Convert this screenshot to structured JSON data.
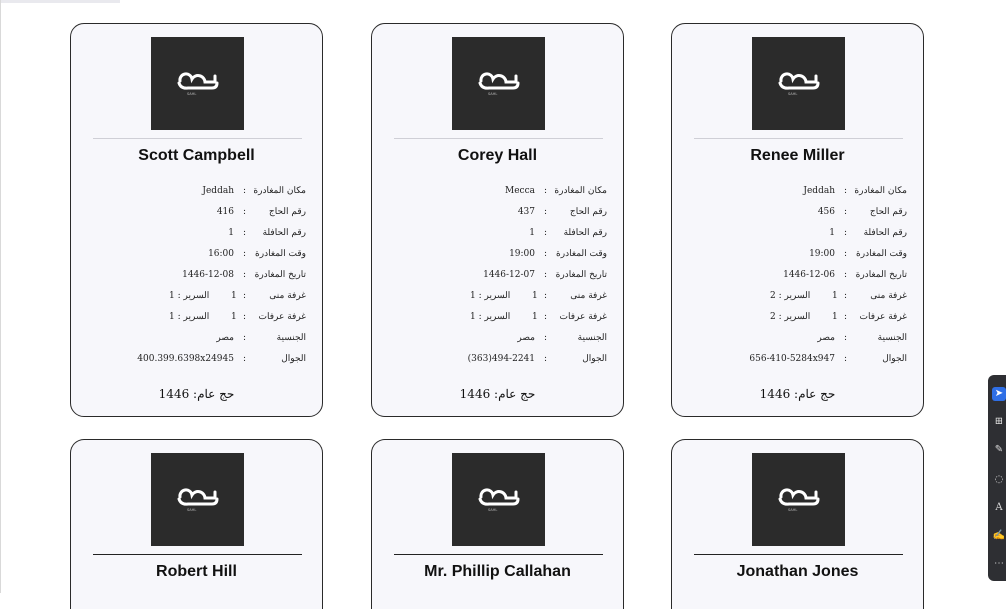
{
  "labels": {
    "departure_place": "مكان المغادرة",
    "pilgrim_no": "رقم الحاج",
    "bus_no": "رقم الحافلة",
    "departure_time": "وقت المغادرة",
    "departure_date": "تاريخ المغادرة",
    "mina_room": "غرفة منى",
    "arafat_room": "غرفة عرفات",
    "nationality": "الجنسية",
    "mobile": "الجوال",
    "bed": "السرير :",
    "sep": ":"
  },
  "year_text": "حج عام: 1446",
  "logo_caption": "SAHL",
  "cards": [
    {
      "name": "Scott Campbell",
      "departure_place": "Jeddah",
      "pilgrim_no": "416",
      "bus_no": "1",
      "departure_time": "16:00",
      "departure_date": "1446-12-08",
      "mina_room": "1",
      "mina_bed": "1",
      "arafat_room": "1",
      "arafat_bed": "1",
      "nationality": "مصر",
      "mobile": "400.399.6398x24945"
    },
    {
      "name": "Corey Hall",
      "departure_place": "Mecca",
      "pilgrim_no": "437",
      "bus_no": "1",
      "departure_time": "19:00",
      "departure_date": "1446-12-07",
      "mina_room": "1",
      "mina_bed": "1",
      "arafat_room": "1",
      "arafat_bed": "1",
      "nationality": "مصر",
      "mobile": "(363)494-2241"
    },
    {
      "name": "Renee Miller",
      "departure_place": "Jeddah",
      "pilgrim_no": "456",
      "bus_no": "1",
      "departure_time": "19:00",
      "departure_date": "1446-12-06",
      "mina_room": "1",
      "mina_bed": "2",
      "arafat_room": "1",
      "arafat_bed": "2",
      "nationality": "مصر",
      "mobile": "656-410-5284x947"
    },
    {
      "name": "Robert Hill"
    },
    {
      "name": "Mr. Phillip Callahan"
    },
    {
      "name": "Jonathan Jones"
    }
  ],
  "toolbar": {
    "tools": [
      "select-tool",
      "add-comment-tool",
      "draw-tool",
      "lasso-tool",
      "text-box-tool",
      "signature-tool",
      "more-tools"
    ]
  }
}
